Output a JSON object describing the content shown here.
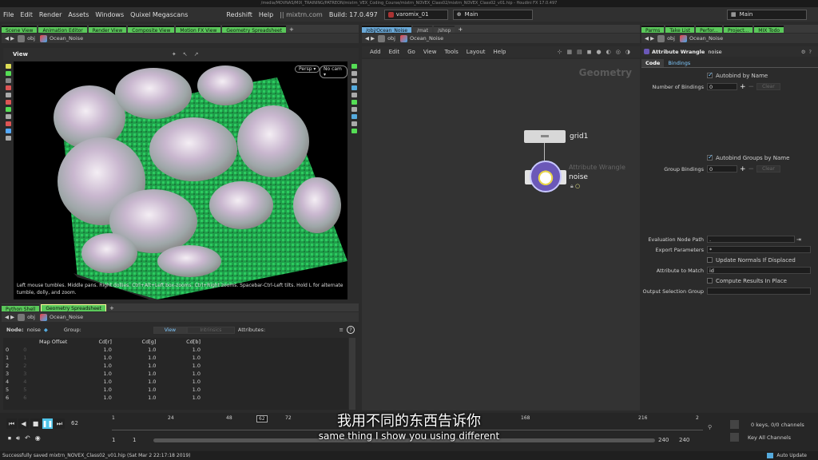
{
  "window_title": "/media/MOVNAS/MIX_TRAINING/PATREON/mixtrn_VEX_Coding_Course/mixtrn_NOVEX_Class02/mixtrn_NOVEX_Class02_v01.hip - Houdini FX 17.0.497",
  "menu": [
    "File",
    "Edit",
    "Render",
    "Assets",
    "Windows",
    "Quixel Megascans"
  ],
  "menu_right": [
    "Redshift",
    "Help"
  ],
  "brand": "mixtrn.com",
  "build": "Build: 17.0.497",
  "desktop": "varomix_01",
  "desk_left": "Main",
  "desk_right": "Main",
  "left_tabs": [
    "Scene View",
    "Animation Editor",
    "Render View",
    "Composite View",
    "Motion FX View",
    "Geometry Spreadsheet"
  ],
  "left_path": {
    "net": "obj",
    "node": "Ocean_Noise"
  },
  "view_label": "View",
  "persp_btn": "Persp",
  "cam_btn": "No cam",
  "viewport_help": "Left mouse tumbles. Middle pans. Right dollies. Ctrl+Alt+Left box-zooms. Ctrl+Right zooms. Spacebar-Ctrl-Left tilts. Hold L for alternate tumble, dolly, and zoom.",
  "bottom_tabs": [
    "Python Shell",
    "Geometry Spreadsheet"
  ],
  "bottom_path": {
    "net": "obj",
    "node": "Ocean_Noise"
  },
  "spreadsheet": {
    "node_label": "Node:",
    "node_value": "noise",
    "group_label": "Group:",
    "view_btn": "View",
    "intrinsics_btn": "Intrinsics",
    "attributes_label": "Attributes:",
    "columns": [
      "",
      "Map Offset",
      "Cd[r]",
      "Cd[g]",
      "Cd[b]"
    ],
    "rows": [
      [
        "0",
        "0",
        "1.0",
        "1.0",
        "1.0"
      ],
      [
        "1",
        "1",
        "1.0",
        "1.0",
        "1.0"
      ],
      [
        "2",
        "2",
        "1.0",
        "1.0",
        "1.0"
      ],
      [
        "3",
        "3",
        "1.0",
        "1.0",
        "1.0"
      ],
      [
        "4",
        "4",
        "1.0",
        "1.0",
        "1.0"
      ],
      [
        "5",
        "5",
        "1.0",
        "1.0",
        "1.0"
      ],
      [
        "6",
        "6",
        "1.0",
        "1.0",
        "1.0"
      ]
    ]
  },
  "mid_tabs": [
    "/obj/Ocean_Noise",
    "/mat",
    "/shop"
  ],
  "mid_path": {
    "net": "obj",
    "node": "Ocean_Noise"
  },
  "mid_menu": [
    "Add",
    "Edit",
    "Go",
    "View",
    "Tools",
    "Layout",
    "Help"
  ],
  "network_watermark": "Geometry",
  "nodes": {
    "grid_name": "grid1",
    "wrangle_type": "Attribute Wrangle",
    "wrangle_name": "noise"
  },
  "right_tabs": [
    "Parms",
    "Take List",
    "Perfor...",
    "Project...",
    "MIX Todo"
  ],
  "right_path": {
    "net": "obj",
    "node": "Ocean_Noise"
  },
  "parm_header": {
    "type": "Attribute Wrangle",
    "name": "noise"
  },
  "parm_tabs": [
    "Code",
    "Bindings"
  ],
  "parms": {
    "autobind": "Autobind by Name",
    "num_bindings_label": "Number of Bindings",
    "num_bindings": "0",
    "clear": "Clear",
    "autobind_groups": "Autobind Groups by Name",
    "group_bindings_label": "Group Bindings",
    "group_bindings": "0",
    "eval_path_label": "Evaluation Node Path",
    "eval_path": ".",
    "export_label": "Export Parameters",
    "export": "*",
    "update_normals": "Update Normals If Displaced",
    "match_label": "Attribute to Match",
    "match": "id",
    "compute_results": "Compute Results In Place",
    "output_group_label": "Output Selection Group"
  },
  "timeline": {
    "current": "62",
    "ticks": [
      "1",
      "24",
      "48",
      "62",
      "72",
      "168",
      "216",
      "2"
    ],
    "start": "1",
    "start2": "1",
    "end": "240",
    "end2": "240"
  },
  "keys_info": "0 keys, 0/0 channels",
  "key_all": "Key All Channels",
  "subtitle_cn": "我用不同的东西告诉你",
  "subtitle_en": "same thing I show you using different",
  "status": "Successfully saved mixtrn_NOVEX_Class02_v01.hip (Sat Mar  2 22:17:18 2019)",
  "auto_update": "Auto Update",
  "colors": {
    "accent_green": "#5ac85a",
    "bg": "#2b2b2b",
    "terrain_green": "#2bb05a",
    "node_purple": "#6b58b8"
  }
}
